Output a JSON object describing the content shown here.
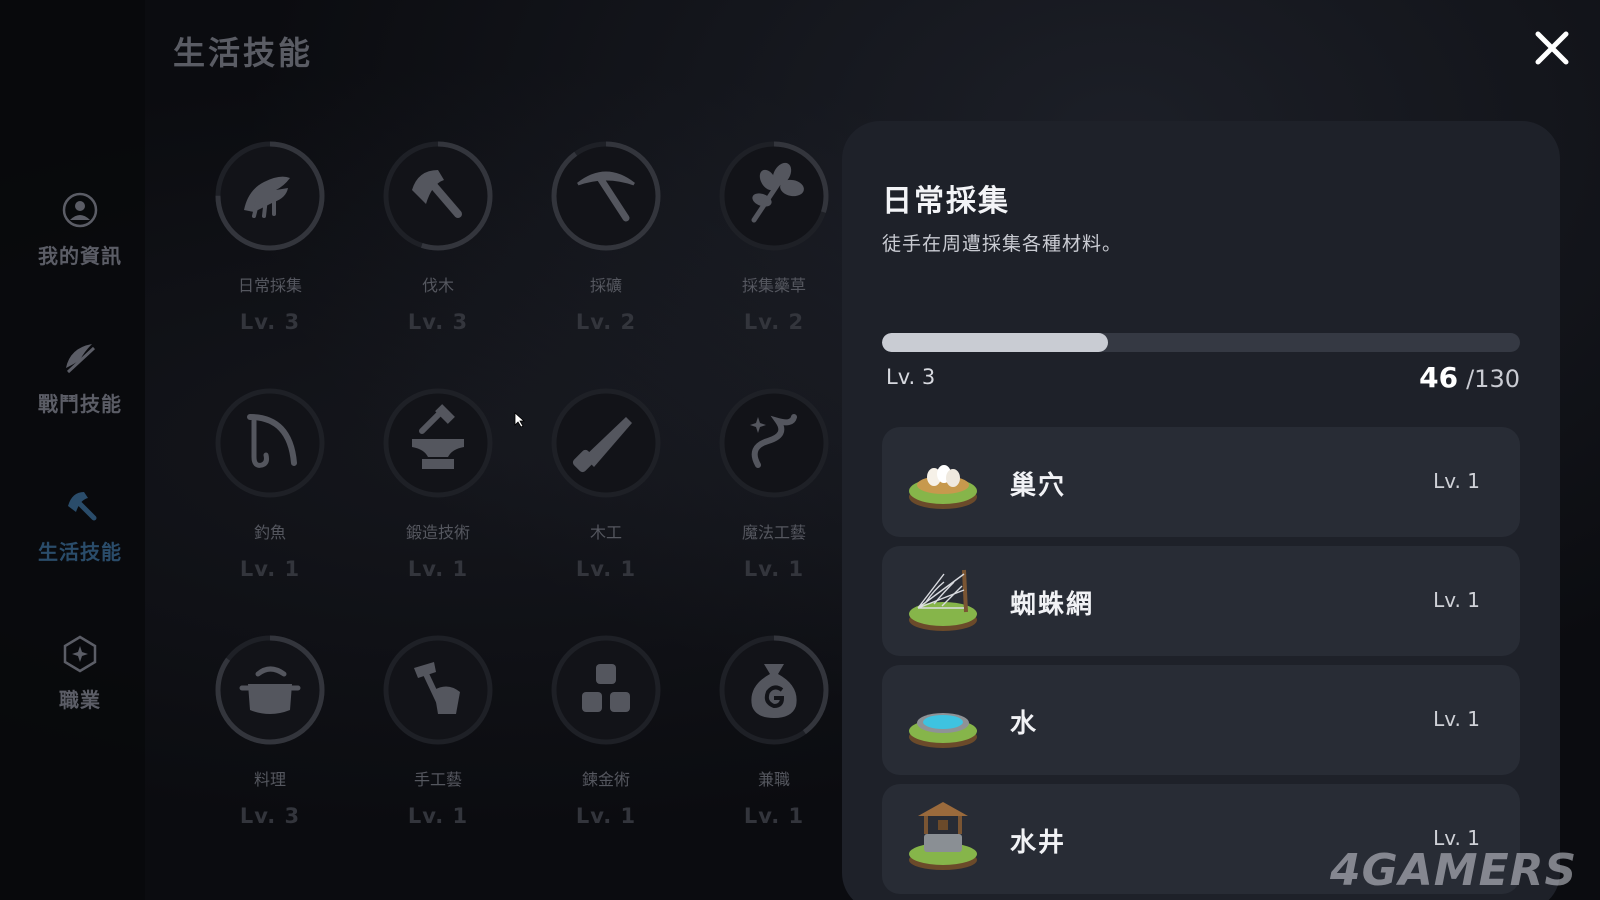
{
  "page": {
    "title": "生活技能"
  },
  "nav": [
    {
      "label": "我的資訊",
      "icon": "profile-icon",
      "active": false
    },
    {
      "label": "戰鬥技能",
      "icon": "combat-icon",
      "active": false
    },
    {
      "label": "生活技能",
      "icon": "axe-icon",
      "active": true
    },
    {
      "label": "職業",
      "icon": "job-icon",
      "active": false
    }
  ],
  "skills": [
    {
      "name": "日常採集",
      "level": "Lv. 3",
      "icon": "gather-hand-icon",
      "progress": 0.75
    },
    {
      "name": "伐木",
      "level": "Lv. 3",
      "icon": "axe-icon",
      "progress": 0.55
    },
    {
      "name": "採礦",
      "level": "Lv. 2",
      "icon": "pickaxe-icon",
      "progress": 0.9
    },
    {
      "name": "採集藥草",
      "level": "Lv. 2",
      "icon": "herb-icon",
      "progress": 0.3
    },
    {
      "name": "釣魚",
      "level": "Lv. 1",
      "icon": "fishing-icon",
      "progress": 0
    },
    {
      "name": "鍛造技術",
      "level": "Lv. 1",
      "icon": "anvil-icon",
      "progress": 0
    },
    {
      "name": "木工",
      "level": "Lv. 1",
      "icon": "saw-icon",
      "progress": 0
    },
    {
      "name": "魔法工藝",
      "level": "Lv. 1",
      "icon": "magic-craft-icon",
      "progress": 0
    },
    {
      "name": "料理",
      "level": "Lv. 3",
      "icon": "cooking-pot-icon",
      "progress": 0.85
    },
    {
      "name": "手工藝",
      "level": "Lv. 1",
      "icon": "hammer-hand-icon",
      "progress": 0
    },
    {
      "name": "鍊金術",
      "level": "Lv. 1",
      "icon": "alchemy-icon",
      "progress": 0
    },
    {
      "name": "兼職",
      "level": "Lv. 1",
      "icon": "money-bag-icon",
      "progress": 0.4
    }
  ],
  "detail": {
    "title": "日常採集",
    "description": "徒手在周遭採集各種材料。",
    "level": "Lv. 3",
    "xp_current": "46",
    "xp_max": "/130",
    "xp_fraction": 0.354,
    "resources": [
      {
        "name": "巢穴",
        "level": "Lv. 1",
        "icon": "nest-icon"
      },
      {
        "name": "蜘蛛網",
        "level": "Lv. 1",
        "icon": "spider-web-icon"
      },
      {
        "name": "水",
        "level": "Lv. 1",
        "icon": "water-icon"
      },
      {
        "name": "水井",
        "level": "Lv. 1",
        "icon": "well-icon"
      }
    ]
  },
  "watermark": "4GAMERS",
  "colors": {
    "accent": "#2a4c6a",
    "panel": "#1e2129",
    "card": "#282c35"
  }
}
